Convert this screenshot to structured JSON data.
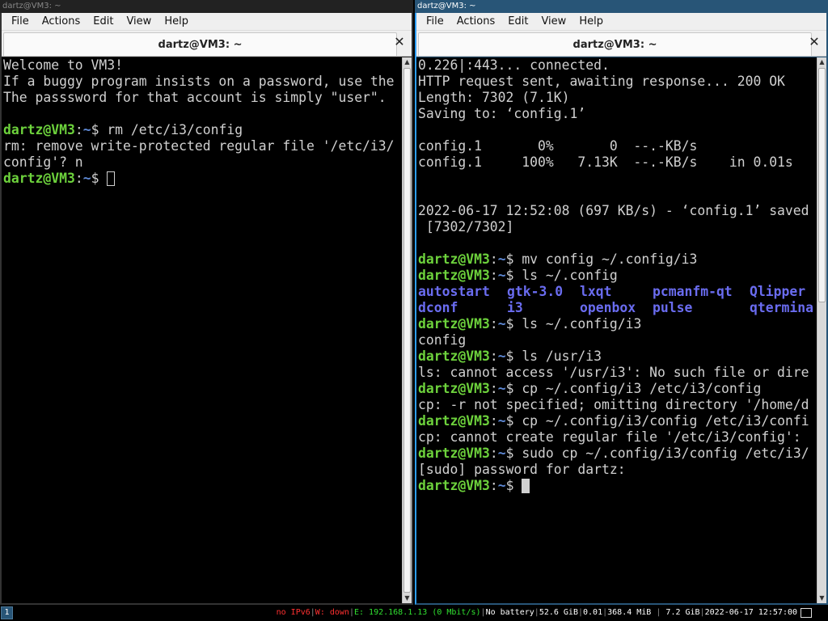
{
  "left": {
    "wm_title": "dartz@VM3: ~",
    "menu": [
      "File",
      "Actions",
      "Edit",
      "View",
      "Help"
    ],
    "tab_title": "dartz@VM3: ~",
    "lines": [
      {
        "text": "Welcome to VM3!"
      },
      {
        "text": "If a buggy program insists on a password, use the"
      },
      {
        "text": "The passsword for that account is simply \"user\"."
      },
      {
        "text": ""
      },
      {
        "prompt": true,
        "user": "dartz@VM3",
        "path": "~",
        "cmd": "rm /etc/i3/config"
      },
      {
        "text": "rm: remove write-protected regular file '/etc/i3/"
      },
      {
        "text": "config'? n"
      },
      {
        "prompt": true,
        "user": "dartz@VM3",
        "path": "~",
        "cmd": "",
        "cursor": "hollow"
      }
    ]
  },
  "right": {
    "wm_title": "dartz@VM3: ~",
    "menu": [
      "File",
      "Actions",
      "Edit",
      "View",
      "Help"
    ],
    "tab_title": "dartz@VM3: ~",
    "lines": [
      {
        "text": "0.226|:443... connected."
      },
      {
        "text": "HTTP request sent, awaiting response... 200 OK"
      },
      {
        "text": "Length: 7302 (7.1K)"
      },
      {
        "text": "Saving to: ‘config.1’"
      },
      {
        "text": ""
      },
      {
        "text": "config.1       0%       0  --.-KB/s"
      },
      {
        "text": "config.1     100%   7.13K  --.-KB/s    in 0.01s"
      },
      {
        "text": ""
      },
      {
        "text": ""
      },
      {
        "text": "2022-06-17 12:52:08 (697 KB/s) - ‘config.1’ saved"
      },
      {
        "text": " [7302/7302]"
      },
      {
        "text": ""
      },
      {
        "prompt": true,
        "user": "dartz@VM3",
        "path": "~",
        "cmd": "mv config ~/.config/i3"
      },
      {
        "prompt": true,
        "user": "dartz@VM3",
        "path": "~",
        "cmd": "ls ~/.config"
      },
      {
        "dirs": [
          "autostart",
          "gtk-3.0",
          "lxqt",
          "pcmanfm-qt",
          "Qlipper"
        ]
      },
      {
        "dirs": [
          "dconf",
          "i3",
          "openbox",
          "pulse",
          "qtermina"
        ]
      },
      {
        "prompt": true,
        "user": "dartz@VM3",
        "path": "~",
        "cmd": "ls ~/.config/i3"
      },
      {
        "text": "config"
      },
      {
        "prompt": true,
        "user": "dartz@VM3",
        "path": "~",
        "cmd": "ls /usr/i3"
      },
      {
        "text": "ls: cannot access '/usr/i3': No such file or dire"
      },
      {
        "prompt": true,
        "user": "dartz@VM3",
        "path": "~",
        "cmd": "cp ~/.config/i3 /etc/i3/config"
      },
      {
        "text": "cp: -r not specified; omitting directory '/home/d"
      },
      {
        "prompt": true,
        "user": "dartz@VM3",
        "path": "~",
        "cmd": "cp ~/.config/i3/config /etc/i3/confi"
      },
      {
        "text": "cp: cannot create regular file '/etc/i3/config':"
      },
      {
        "prompt": true,
        "user": "dartz@VM3",
        "path": "~",
        "cmd": "sudo cp ~/.config/i3/config /etc/i3/"
      },
      {
        "text": "[sudo] password for dartz:"
      },
      {
        "prompt": true,
        "user": "dartz@VM3",
        "path": "~",
        "cmd": "",
        "cursor": "solid"
      }
    ]
  },
  "statusbar": {
    "workspace": "1",
    "ipv6": "no IPv6",
    "wifi": "W: down",
    "ethernet": "E: 192.168.1.13 (0 Mbit/s)",
    "battery": "No battery",
    "disk": "52.6 GiB",
    "load": "0.01",
    "memory": "368.4 MiB",
    "memory_total": "7.2 GiB",
    "datetime": "2022-06-17 12:57:00",
    "separator": "|",
    "tray_icon": "network-monitor-icon"
  }
}
